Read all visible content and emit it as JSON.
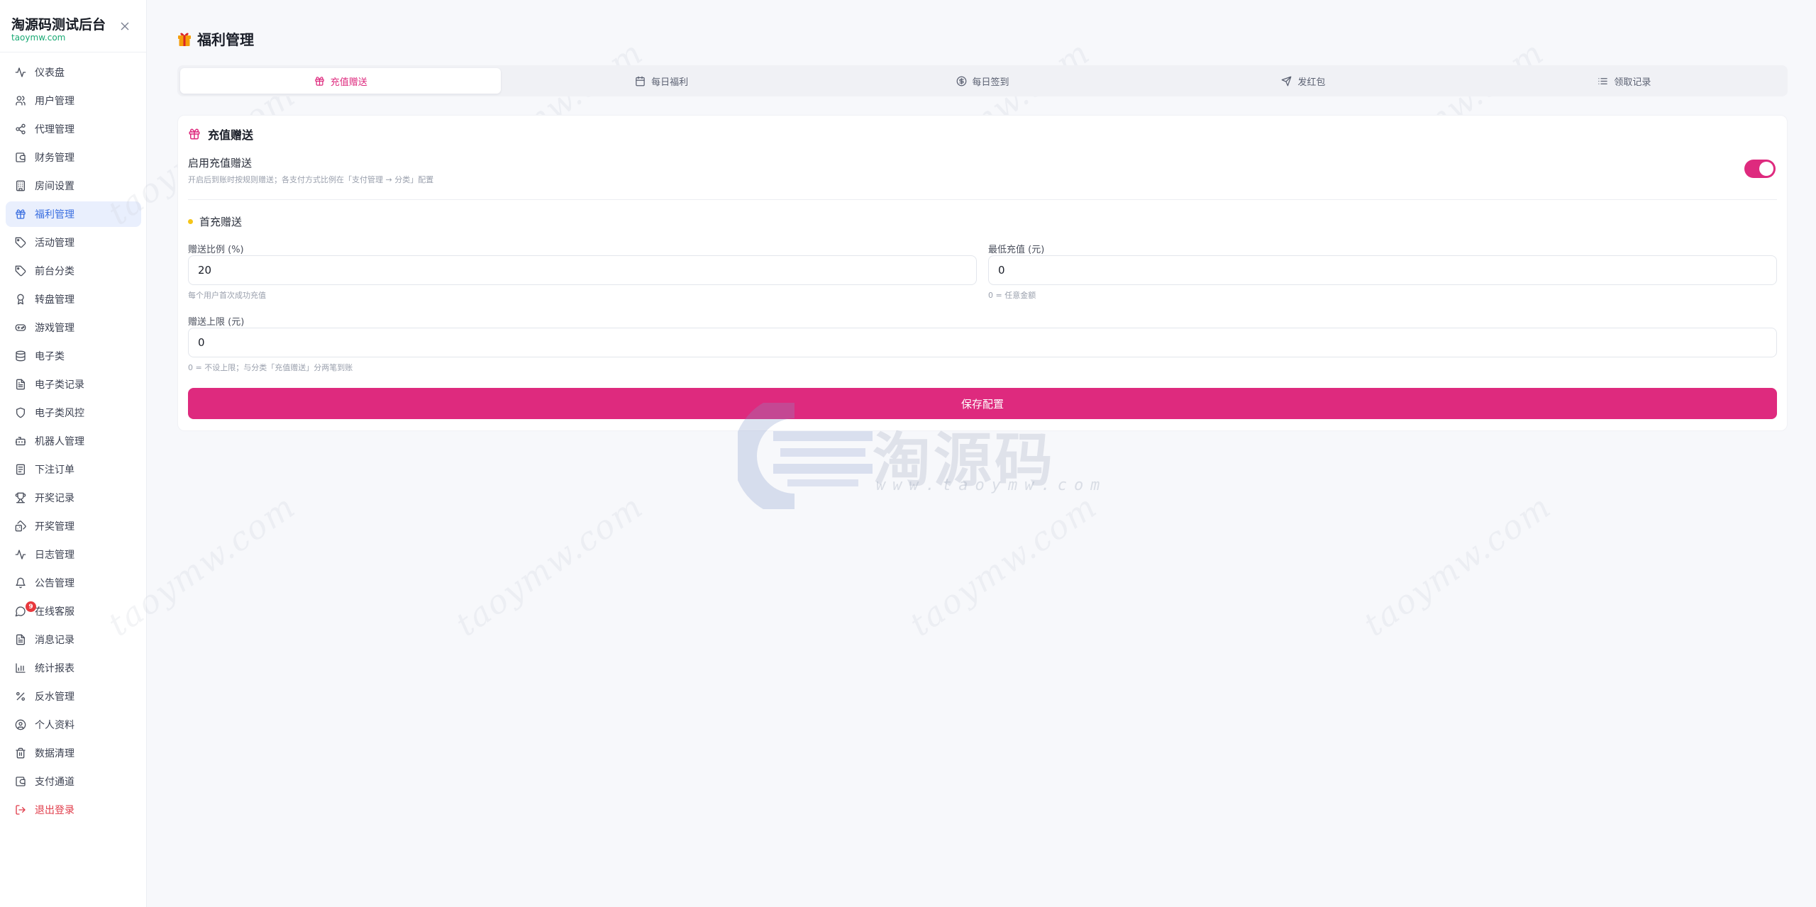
{
  "brand": {
    "title": "淘源码测试后台",
    "subtitle": "taoymw.com"
  },
  "sidebar": {
    "items": [
      {
        "label": "仪表盘",
        "icon": "activity-icon"
      },
      {
        "label": "用户管理",
        "icon": "users-icon"
      },
      {
        "label": "代理管理",
        "icon": "share-icon"
      },
      {
        "label": "财务管理",
        "icon": "wallet-icon"
      },
      {
        "label": "房间设置",
        "icon": "building-icon"
      },
      {
        "label": "福利管理",
        "icon": "gift-icon",
        "active": true
      },
      {
        "label": "活动管理",
        "icon": "tag-icon"
      },
      {
        "label": "前台分类",
        "icon": "tag-icon"
      },
      {
        "label": "转盘管理",
        "icon": "award-icon"
      },
      {
        "label": "游戏管理",
        "icon": "gamepad-icon"
      },
      {
        "label": "电子类",
        "icon": "database-icon"
      },
      {
        "label": "电子类记录",
        "icon": "file-text-icon"
      },
      {
        "label": "电子类风控",
        "icon": "shield-icon"
      },
      {
        "label": "机器人管理",
        "icon": "bot-icon"
      },
      {
        "label": "下注订单",
        "icon": "receipt-icon"
      },
      {
        "label": "开奖记录",
        "icon": "trophy-icon"
      },
      {
        "label": "开奖管理",
        "icon": "dice-icon"
      },
      {
        "label": "日志管理",
        "icon": "activity-icon"
      },
      {
        "label": "公告管理",
        "icon": "bell-icon"
      },
      {
        "label": "在线客服",
        "icon": "chat-icon",
        "badge": "9"
      },
      {
        "label": "消息记录",
        "icon": "file-text-icon"
      },
      {
        "label": "统计报表",
        "icon": "bar-chart-icon"
      },
      {
        "label": "反水管理",
        "icon": "percent-icon"
      },
      {
        "label": "个人资料",
        "icon": "user-circle-icon"
      },
      {
        "label": "数据清理",
        "icon": "trash-icon"
      },
      {
        "label": "支付通道",
        "icon": "wallet-icon"
      },
      {
        "label": "退出登录",
        "icon": "logout-icon",
        "danger": true
      }
    ]
  },
  "page": {
    "title": "福利管理"
  },
  "tabs": [
    {
      "label": "充值赠送",
      "icon": "gift-icon",
      "active": true
    },
    {
      "label": "每日福利",
      "icon": "calendar-icon"
    },
    {
      "label": "每日签到",
      "icon": "coin-icon"
    },
    {
      "label": "发红包",
      "icon": "send-icon"
    },
    {
      "label": "领取记录",
      "icon": "list-icon"
    }
  ],
  "card": {
    "title": "充值赠送",
    "enable_label": "启用充值赠送",
    "enable_desc": "开启后到账时按规则赠送；各支付方式比例在「支付管理 → 分类」配置",
    "enabled": true,
    "section_title": "首充赠送",
    "fields": {
      "ratio": {
        "label": "赠送比例 (%)",
        "value": "20",
        "hint": "每个用户首次成功充值"
      },
      "min": {
        "label": "最低充值 (元)",
        "value": "0",
        "hint": "0 = 任意金额"
      },
      "cap": {
        "label": "赠送上限 (元)",
        "value": "0",
        "hint": "0 = 不设上限；与分类「充值赠送」分两笔到账"
      }
    },
    "save_label": "保存配置"
  },
  "watermark": {
    "text": "taoymw.com",
    "logo_text": "淘源码",
    "logo_url": "www.taoymw.com"
  },
  "colors": {
    "accent": "#de2a7e",
    "active_nav": "#3b6fe0",
    "danger": "#e03c4a",
    "brand_sub": "#19a974"
  }
}
